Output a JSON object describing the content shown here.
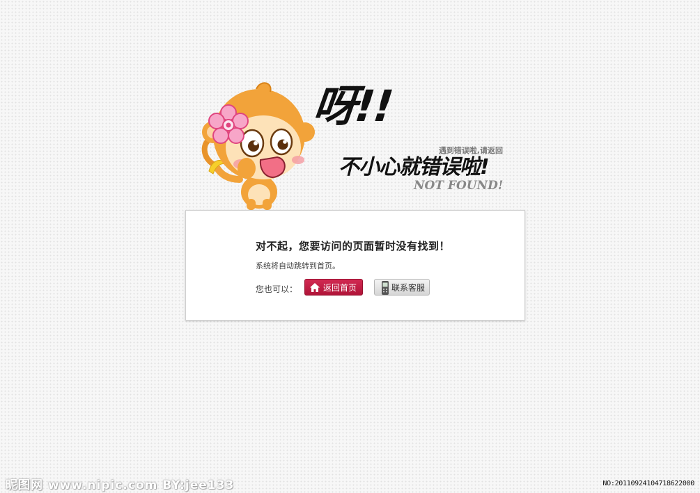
{
  "hero": {
    "exclaim": "呀!!",
    "tip": "遇到错误啦,请返回",
    "headline": "不小心就错误啦!",
    "not_found": "NOT FOUND!"
  },
  "box": {
    "title": "对不起，您要访问的页面暂时没有找到！",
    "subtitle": "系统将自动跳转到首页。",
    "also_label": "您也可以：",
    "home_button": "返回首页",
    "contact_button": "联系客服"
  },
  "watermark": {
    "left": "昵图网 www.nipic.com   BY:jee133",
    "right": "NO:20110924104718622000"
  },
  "colors": {
    "home_button": "#c01a43",
    "box_border": "#cfcfcf",
    "background": "#f7f7f7"
  },
  "icons": [
    "monkey-mascot",
    "home-icon",
    "phone-icon"
  ]
}
